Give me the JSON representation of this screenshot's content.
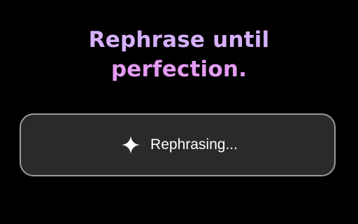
{
  "headline": {
    "line1": "Rephrase until",
    "line2": "perfection.",
    "color_line1": "#d6b0fb",
    "color_line2": "#e49bf2"
  },
  "status": {
    "icon": "sparkle-icon",
    "label": "Rephrasing..."
  },
  "colors": {
    "background": "#000000",
    "panel_background": "#2a2a2a",
    "panel_border": "#9a9a9a",
    "text": "#ffffff"
  }
}
